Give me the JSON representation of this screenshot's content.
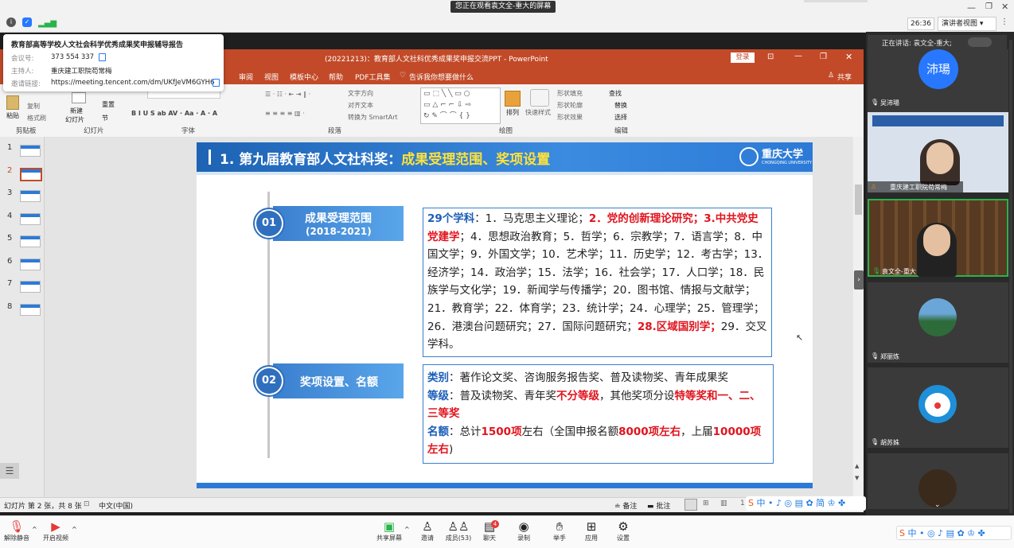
{
  "meeting": {
    "share_banner": "您正在观看袁文全-重大的屏幕",
    "timer": "26:36",
    "view_mode": "演讲者视图"
  },
  "info": {
    "title": "教育部高等学校人文社会科学优秀成果奖申报辅导报告",
    "meeting_id_label": "会议号:",
    "meeting_id": "373 554 337",
    "host_label": "主持人:",
    "host": "重庆建工职院苟常梅",
    "link_label": "邀请链接:",
    "link": "https://meeting.tencent.com/dm/UKfJeVM6GYH6"
  },
  "ppt": {
    "title": "(20221213)：教育部人文社科优秀成果奖申报交流PPT - PowerPoint",
    "login": "登录",
    "tabs": [
      "审阅",
      "视图",
      "模板中心",
      "帮助",
      "PDF工具集"
    ],
    "tell_me": "告诉我你想要做什么",
    "share": "共享",
    "groups": {
      "clipboard": "剪贴板",
      "slides": "幻灯片",
      "font": "字体",
      "paragraph": "段落",
      "drawing": "绘图",
      "editing": "编辑"
    },
    "ribbon": {
      "paste": "粘贴",
      "copy": "复制",
      "format_painter": "格式刷",
      "new_slide": "新建",
      "new_slide2": "幻灯片",
      "reset": "重置",
      "section": "节",
      "text_direction": "文字方向",
      "align_text": "对齐文本",
      "smartart": "转换为 SmartArt",
      "arrange": "排列",
      "quick_styles": "快速样式",
      "shape_fill": "形状填充",
      "shape_outline": "形状轮廓",
      "shape_effects": "形状效果",
      "find": "查找",
      "replace": "替换",
      "select": "选择"
    },
    "slide_numbers": [
      "1",
      "2",
      "3",
      "4",
      "5",
      "6",
      "7",
      "8"
    ],
    "status": {
      "slide_info": "幻灯片 第 2 张，共 8 张",
      "language": "中文(中国)",
      "notes": "备注",
      "comments": "批注"
    }
  },
  "slide": {
    "header_prefix": "1. 第九届教育部人文社科奖：",
    "header_highlight": "成果受理范围、奖项设置",
    "university": "重庆大学",
    "university_en": "CHONGQING UNIVERSITY",
    "item1": {
      "num": "01",
      "title": "成果受理范围",
      "subtitle": "(2018-2021)"
    },
    "item2": {
      "num": "02",
      "title": "奖项设置、名额"
    },
    "box1": [
      {
        "t": "29个学科",
        "c": "blue"
      },
      {
        "t": "：1．马克思主义理论；",
        "c": ""
      },
      {
        "t": "2．党的创新理论研究；3.中共党史党建学",
        "c": "red"
      },
      {
        "t": "；4．思想政治教育；5．哲学；6．宗教学；7．语言学；8．中国文学；9．外国文学；10．艺术学；11．历史学；12．考古学；13．经济学；14．政治学；15．法学；16．社会学；17．人口学；18．民族学与文化学；19．新闻学与传播学；20．图书馆、情报与文献学；21．教育学；22．体育学；23．统计学；24．心理学；25．管理学；26．港澳台问题研究；27．国际问题研究；",
        "c": ""
      },
      {
        "t": "28.区域国别学；",
        "c": "red"
      },
      {
        "t": "29．交叉学科。",
        "c": ""
      }
    ],
    "box2": [
      {
        "t": "类别",
        "c": "blue"
      },
      {
        "t": "：著作论文奖、咨询服务报告奖、普及读物奖、青年成果奖",
        "c": ""
      },
      {
        "br": true
      },
      {
        "t": "等级",
        "c": "blue"
      },
      {
        "t": "：普及读物奖、青年奖",
        "c": ""
      },
      {
        "t": "不分等级",
        "c": "red"
      },
      {
        "t": "，其他奖项分设",
        "c": ""
      },
      {
        "t": "特等奖和一、二、三等奖",
        "c": "red"
      },
      {
        "br": true
      },
      {
        "t": "名额",
        "c": "blue"
      },
      {
        "t": "：总计",
        "c": ""
      },
      {
        "t": "1500项",
        "c": "red"
      },
      {
        "t": "左右（全国申报名额",
        "c": ""
      },
      {
        "t": "8000项左右",
        "c": "red"
      },
      {
        "t": "，上届",
        "c": ""
      },
      {
        "t": "10000项左右",
        "c": "red"
      },
      {
        "t": ")",
        "c": ""
      }
    ]
  },
  "participants": {
    "speaking": "正在讲话: 袁文全-重大;",
    "tiles": [
      {
        "name": "吴沛瑒",
        "avatar_text": "沛瑒"
      },
      {
        "name": "重庆建工职院苟常梅"
      },
      {
        "name": "袁文全-重大"
      },
      {
        "name": "郑丽炼"
      },
      {
        "name": "胡苏姝"
      }
    ]
  },
  "toolbar": {
    "mute": "解除静音",
    "video": "开启视频",
    "share": "共享屏幕",
    "invite": "邀请",
    "members": "成员(53)",
    "chat": "聊天",
    "chat_badge": "4",
    "record": "录制",
    "raise": "举手",
    "apps": "应用",
    "settings": "设置"
  },
  "colors": {
    "ppt_red": "#c24a28",
    "slide_blue": "#1e63b4",
    "accent_blue": "#2878ff"
  }
}
